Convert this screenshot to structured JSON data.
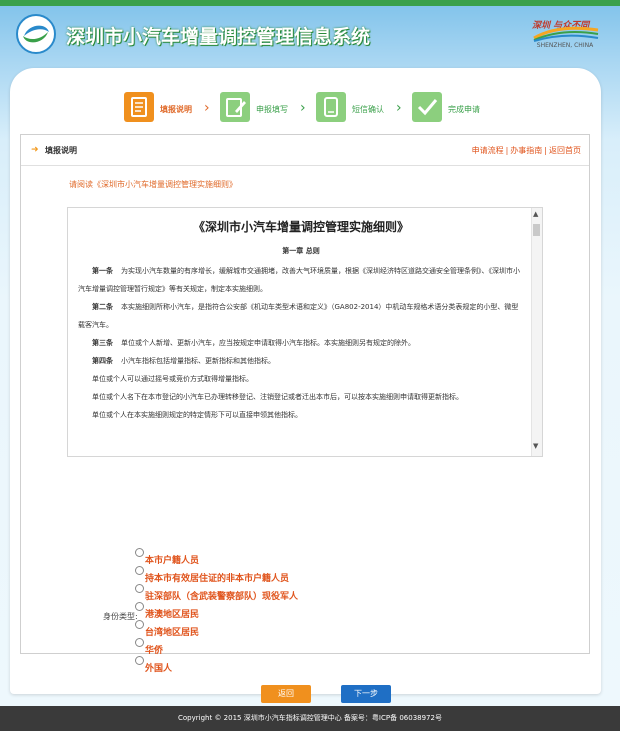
{
  "header": {
    "title": "深圳市小汽车增量调控管理信息系统",
    "city_logo_text": "SHENZHEN, CHINA",
    "city_logo_calligraphy": "深圳 与众不同"
  },
  "steps": [
    {
      "label": "填报说明",
      "icon": "document-icon",
      "active": true
    },
    {
      "label": "申报填写",
      "icon": "edit-icon",
      "active": false
    },
    {
      "label": "短信确认",
      "icon": "sms-icon",
      "active": false
    },
    {
      "label": "完成申请",
      "icon": "check-icon",
      "active": false
    }
  ],
  "section": {
    "title": "填报说明",
    "links": [
      "申请流程",
      "办事指南",
      "返回首页"
    ]
  },
  "note": "请阅读《深圳市小汽车增量调控管理实施细则》",
  "document": {
    "title": "《深圳市小汽车增量调控管理实施细则》",
    "chapter": "第一章 总则",
    "paragraphs": [
      {
        "head": "第一条",
        "text": "为实现小汽车数量的有序增长，缓解城市交通拥堵，改善大气环境质量，根据《深圳经济特区道路交通安全管理条例》、《深圳市小汽车增量调控管理暂行规定》等有关规定，制定本实施细则。"
      },
      {
        "head": "第二条",
        "text": "本实施细则所称小汽车，是指符合公安部《机动车类型术语和定义》（GA802-2014）中机动车规格术语分类表规定的小型、微型载客汽车。"
      },
      {
        "head": "第三条",
        "text": "单位或个人新增、更新小汽车，应当按规定申请取得小汽车指标。本实施细则另有规定的除外。"
      },
      {
        "head": "第四条",
        "text": "小汽车指标包括增量指标、更新指标和其他指标。"
      },
      {
        "head": "",
        "text": "单位或个人可以通过摇号或竞价方式取得增量指标。"
      },
      {
        "head": "",
        "text": "单位或个人名下在本市登记的小汽车已办理转移登记、注销登记或者迁出本市后，可以按本实施细则申请取得更新指标。"
      },
      {
        "head": "",
        "text": "单位或个人在本实施细则规定的特定情形下可以直接申领其他指标。"
      }
    ]
  },
  "identity": {
    "label": "身份类型:",
    "options": [
      "本市户籍人员",
      "持本市有效居住证的非本市户籍人员",
      "驻深部队（含武装警察部队）现役军人",
      "港澳地区居民",
      "台湾地区居民",
      "华侨",
      "外国人"
    ]
  },
  "buttons": {
    "back": "返回",
    "next": "下一步"
  },
  "footer": "Copyright © 2015 深圳市小汽车指标调控管理中心  备案号：粤ICP备 06038972号"
}
